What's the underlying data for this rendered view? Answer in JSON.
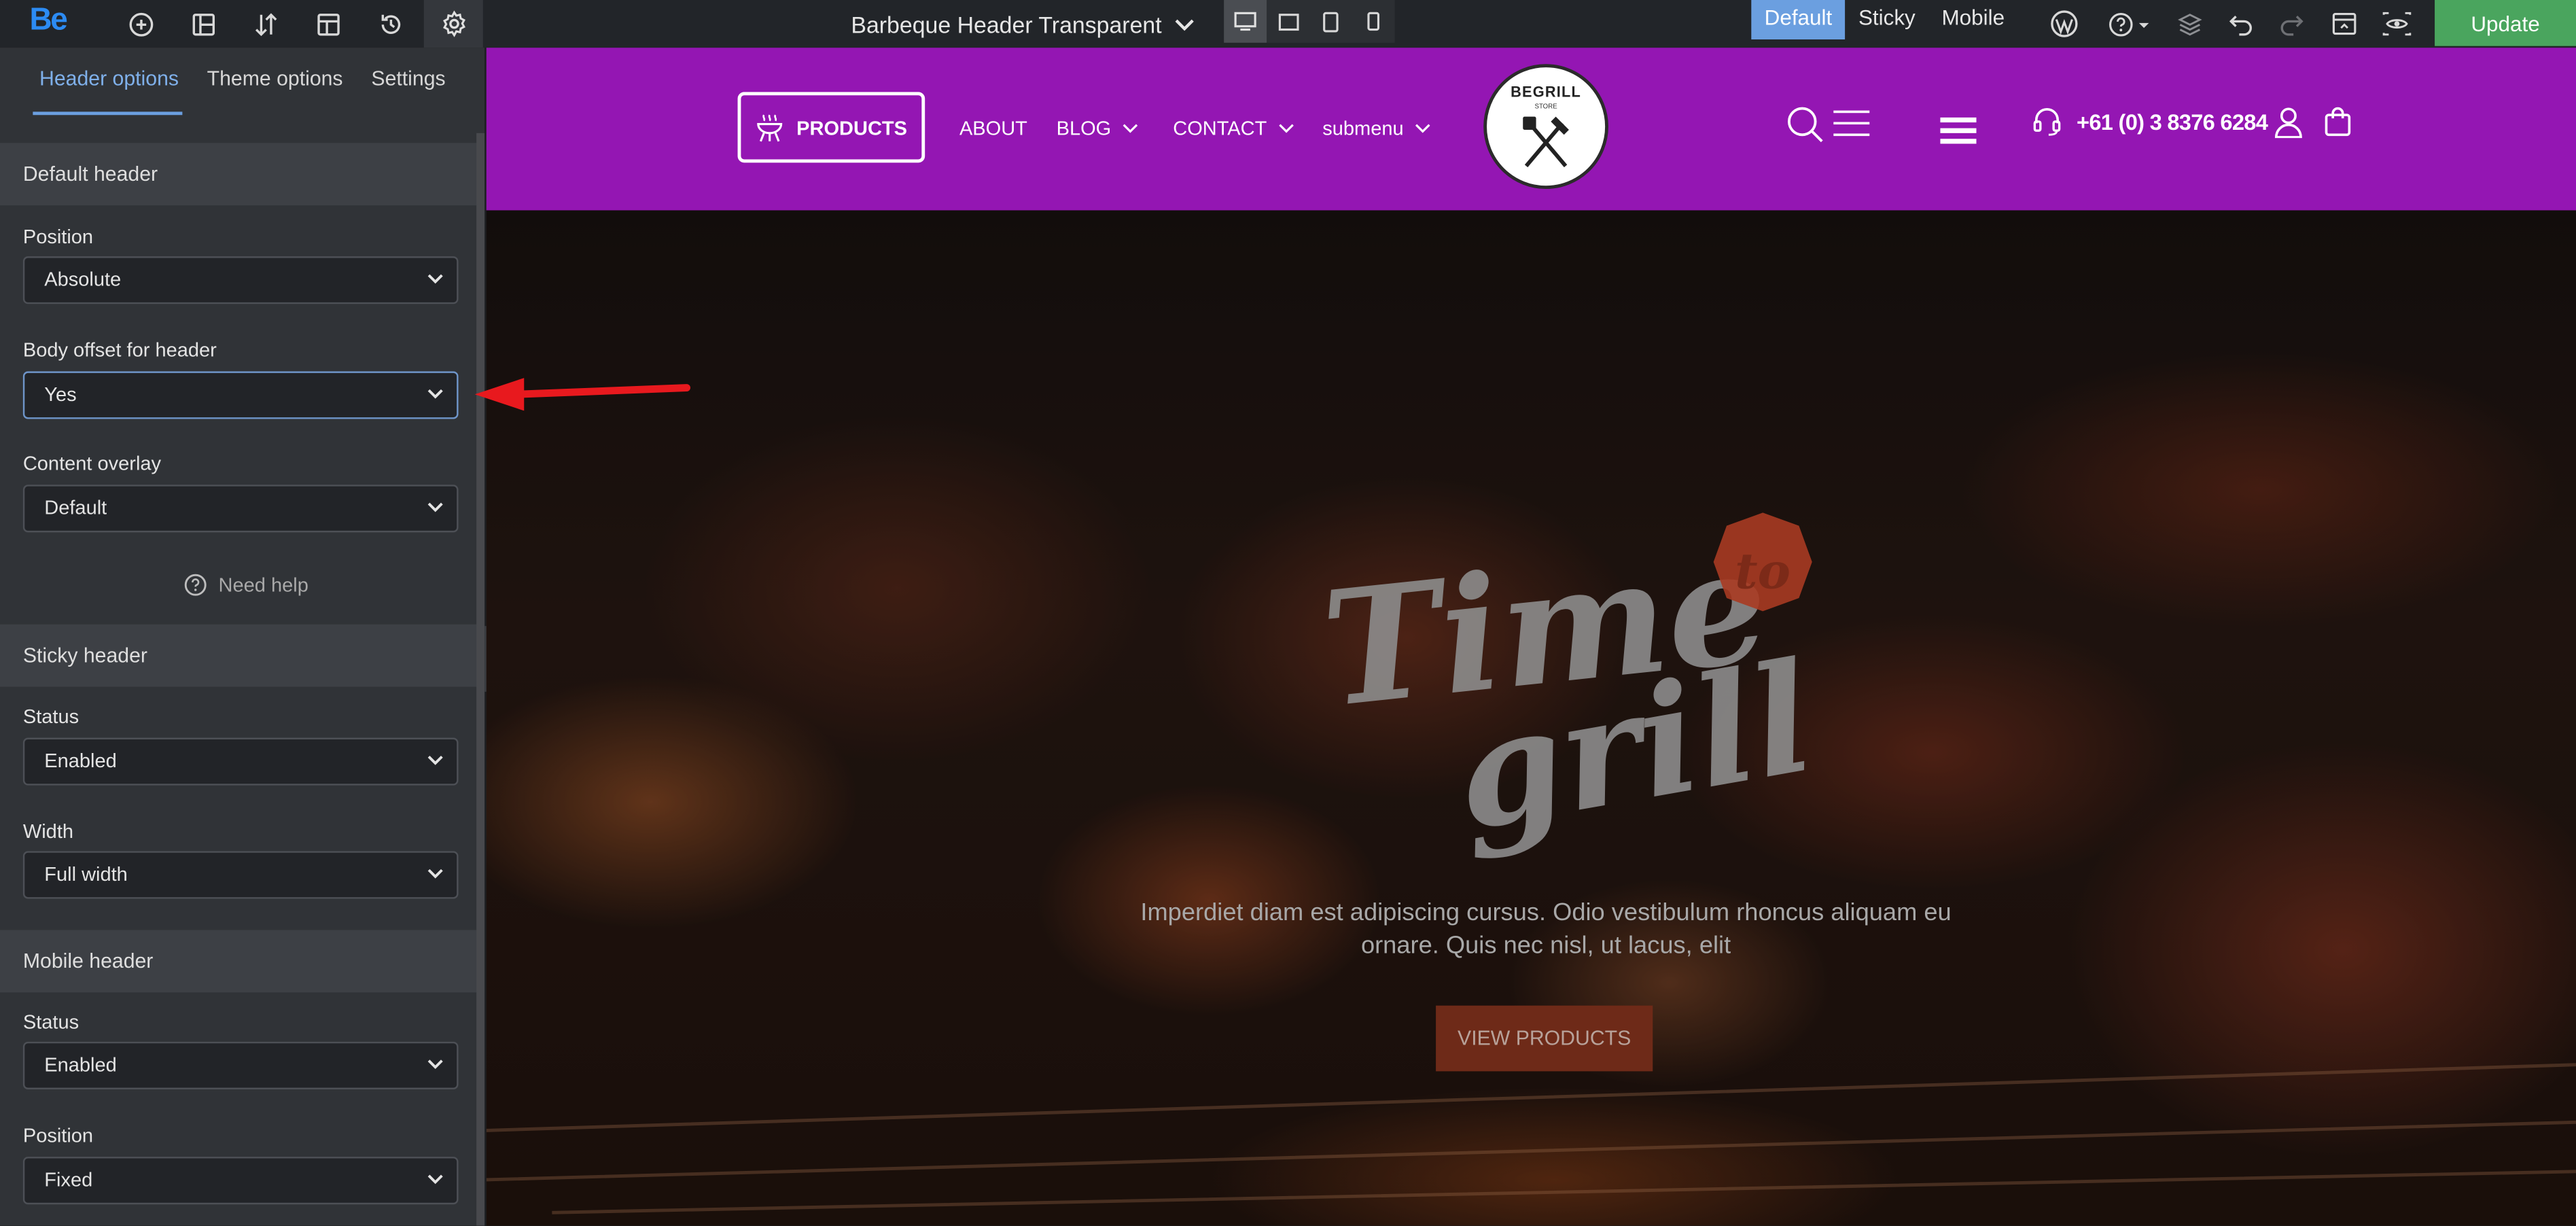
{
  "topbar": {
    "logo": "Be",
    "page_title": "Barbeque Header Transparent",
    "modes": [
      "Default",
      "Sticky",
      "Mobile"
    ],
    "active_mode": "Default",
    "update_label": "Update"
  },
  "sidebar": {
    "tabs": [
      "Header options",
      "Theme options",
      "Settings"
    ],
    "active_tab": "Header options",
    "default_header": {
      "title": "Default header",
      "position_label": "Position",
      "position_value": "Absolute",
      "body_offset_label": "Body offset for header",
      "body_offset_value": "Yes",
      "content_overlay_label": "Content overlay",
      "content_overlay_value": "Default",
      "need_help": "Need help"
    },
    "sticky_header": {
      "title": "Sticky header",
      "status_label": "Status",
      "status_value": "Enabled",
      "width_label": "Width",
      "width_value": "Full width"
    },
    "mobile_header": {
      "title": "Mobile header",
      "status_label": "Status",
      "status_value": "Enabled",
      "position_label": "Position",
      "position_value": "Fixed"
    }
  },
  "preview": {
    "header": {
      "products_button": "PRODUCTS",
      "nav": [
        "ABOUT",
        "BLOG",
        "CONTACT",
        "submenu"
      ],
      "logo_text": "BEGRILL",
      "logo_sub": "STORE",
      "phone": "+61 (0) 3 8376 6284",
      "background_color": "#9416b3"
    },
    "hero": {
      "script_line1": "Time",
      "script_badge": "to",
      "script_line2": "grill",
      "description": "Imperdiet diam est adipiscing cursus. Odio vestibulum rhoncus aliquam eu ornare. Quis nec nisl, ut lacus, elit",
      "button_label": "VIEW PRODUCTS"
    }
  },
  "colors": {
    "accent": "#6b9fe0",
    "update_green": "#4aa55e",
    "annotation_arrow": "#e8191e"
  }
}
